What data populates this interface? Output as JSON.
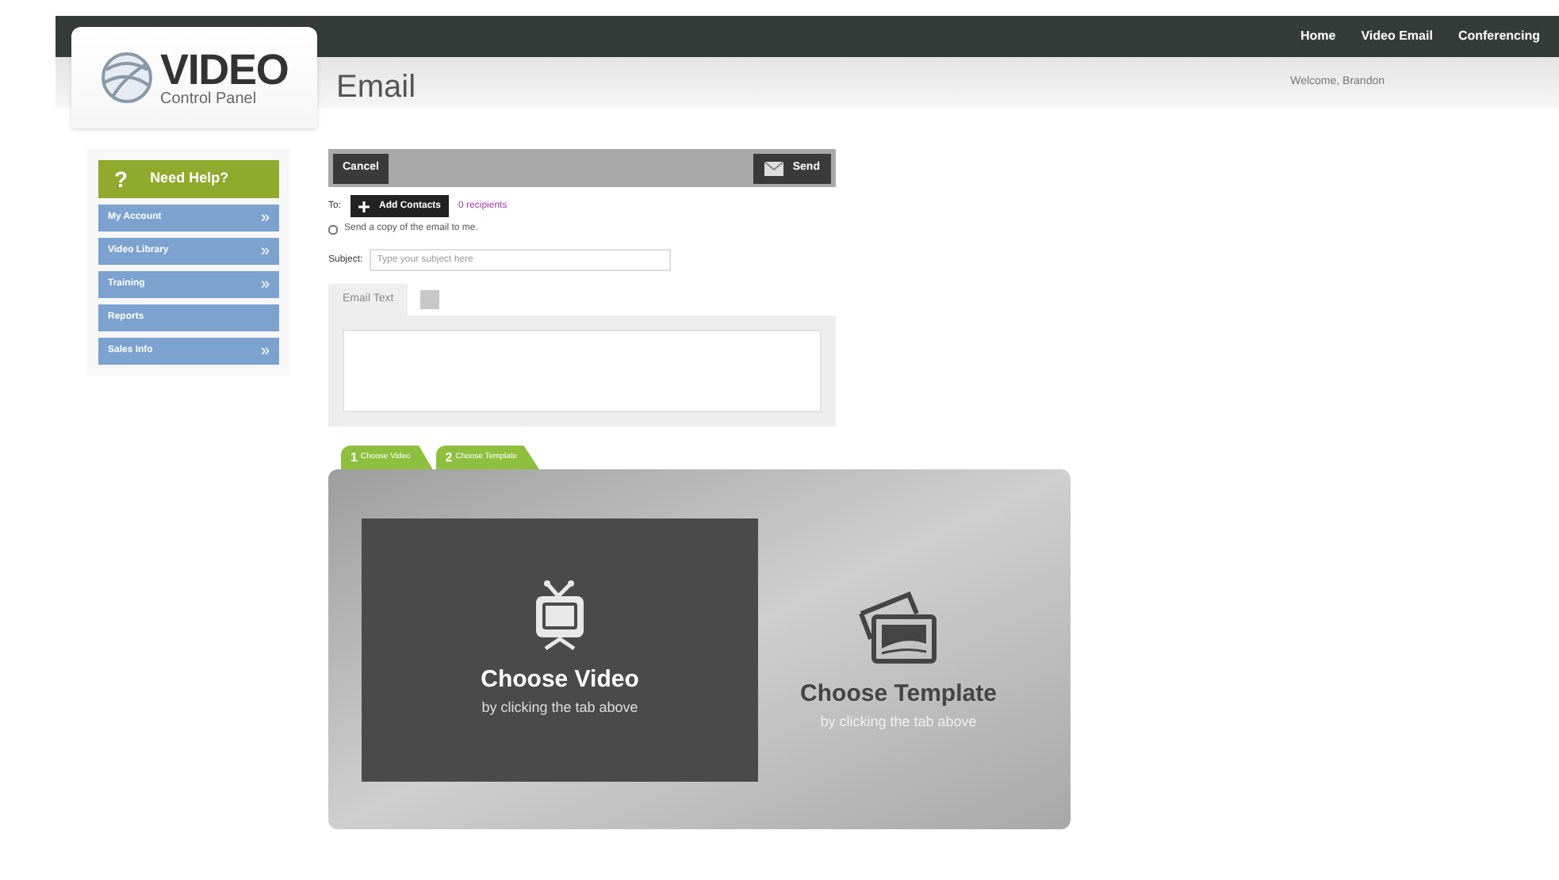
{
  "logo": {
    "title": "VIDEO",
    "subtitle": "Control Panel"
  },
  "page_title": "Email",
  "top_nav": [
    "Home",
    "Video Email",
    "Conferencing"
  ],
  "welcome": "Welcome, Brandon",
  "sidebar": {
    "help": {
      "icon": "?",
      "label": "Need Help?"
    },
    "items": [
      {
        "label": "My Account",
        "chevron": "»"
      },
      {
        "label": "Video Library",
        "chevron": "»"
      },
      {
        "label": "Training",
        "chevron": "»"
      },
      {
        "label": "Reports"
      },
      {
        "label": "Sales Info",
        "chevron": "»"
      }
    ]
  },
  "toolbar": {
    "cancel": "Cancel",
    "send": "Send"
  },
  "to": {
    "label": "To:",
    "add": "Add Contacts",
    "recipients": "0 recipients"
  },
  "copy": {
    "label": "Send a copy of the email to me.",
    "checked": false
  },
  "subject": {
    "label": "Subject:",
    "placeholder": "Type your subject here"
  },
  "email_text": {
    "label": "Email Text"
  },
  "tabs": [
    {
      "number": "1",
      "label": "Choose Video"
    },
    {
      "number": "2",
      "label": "Choose Template"
    }
  ],
  "panels": [
    {
      "kind": "video",
      "title": "Choose Video",
      "hint": "by clicking the tab above",
      "selected": true
    },
    {
      "kind": "template",
      "title": "Choose Template",
      "hint": "by clicking the tab above",
      "selected": false
    }
  ]
}
